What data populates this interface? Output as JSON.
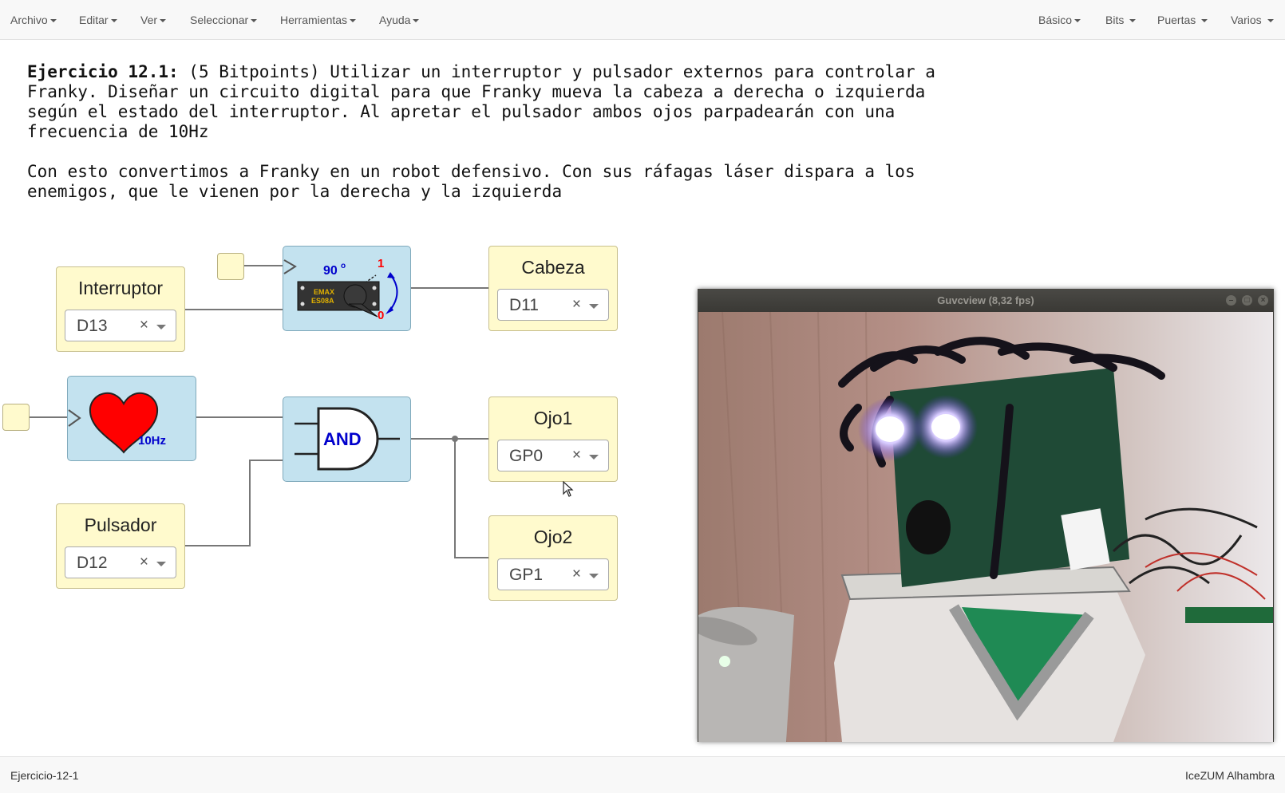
{
  "menubar": {
    "left": [
      "Archivo",
      "Editar",
      "Ver",
      "Seleccionar",
      "Herramientas",
      "Ayuda"
    ],
    "right": [
      "Básico",
      "Bits",
      "Puertas",
      "Varios"
    ]
  },
  "description": {
    "heading": "Ejercicio 12.1:",
    "paragraph1": " (5 Bitpoints) Utilizar un interruptor y pulsador externos para controlar a Franky. Diseñar un circuito digital para que Franky mueva la cabeza a derecha o izquierda según el estado del interruptor. Al apretar el pulsador ambos ojos parpadearán con una frecuencia de 10Hz",
    "paragraph2": "Con esto convertimos a Franky en un robot defensivo. Con sus ráfagas láser dispara a los enemigos, que le vienen por la derecha y la izquierda"
  },
  "blocks": {
    "interruptor": {
      "title": "Interruptor",
      "pin": "D13"
    },
    "pulsador": {
      "title": "Pulsador",
      "pin": "D12"
    },
    "cabeza": {
      "title": "Cabeza",
      "pin": "D11"
    },
    "ojo1": {
      "title": "Ojo1",
      "pin": "GP0"
    },
    "ojo2": {
      "title": "Ojo2",
      "pin": "GP1"
    },
    "clear_symbol": "×",
    "servo": {
      "angle": "90",
      "degree": "o",
      "one": "1",
      "zero": "0",
      "brand": "EMAX",
      "model": "ES08A"
    },
    "heart": {
      "freq": "10Hz"
    },
    "gate": {
      "label": "AND"
    }
  },
  "camera": {
    "title": "Guvcview  (8,32 fps)"
  },
  "status": {
    "left": "Ejercicio-12-1",
    "right": "IceZUM Alhambra"
  },
  "colors": {
    "pin_block": "#fffacd",
    "module_block": "#c3e2ef",
    "heart": "#ff0000",
    "servo_angle": "#0000cc",
    "servo_bit": "#ff0000",
    "gate_label": "#0000cc",
    "wire": "#777777"
  }
}
